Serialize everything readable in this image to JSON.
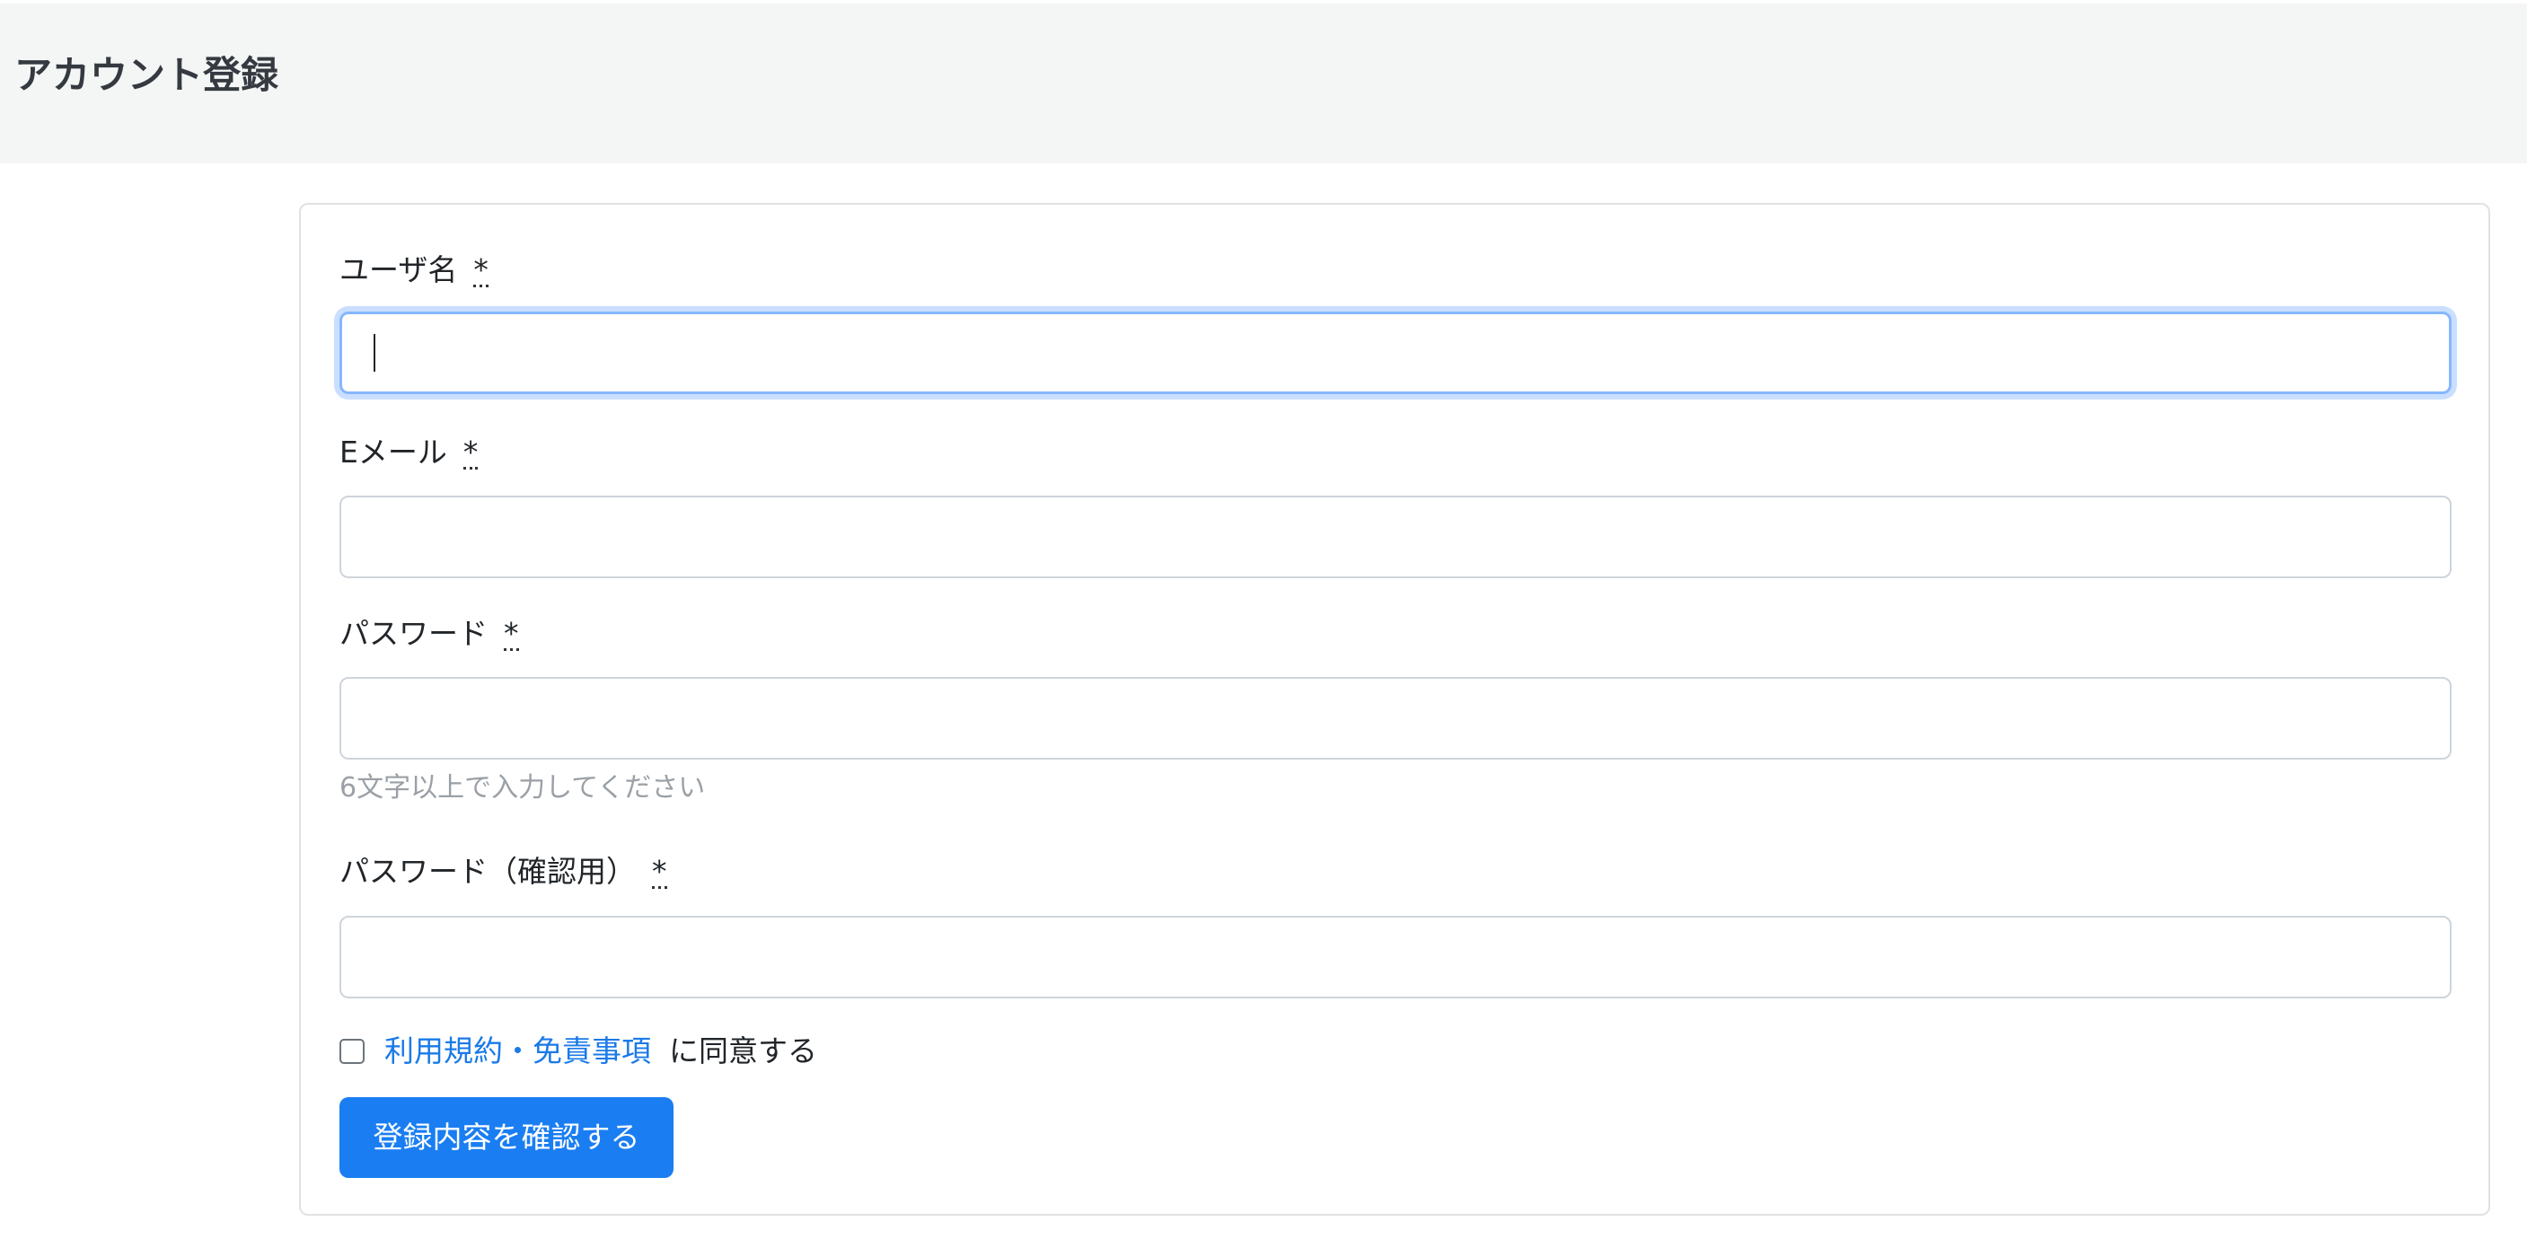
{
  "header": {
    "title": "アカウント登録"
  },
  "form": {
    "required_mark": "*",
    "username": {
      "label": "ユーザ名",
      "value": ""
    },
    "email": {
      "label": "Eメール",
      "value": ""
    },
    "password": {
      "label": "パスワード",
      "value": "",
      "help": "6文字以上で入力してください"
    },
    "password_confirm": {
      "label": "パスワード（確認用）",
      "value": ""
    },
    "terms": {
      "link_text": "利用規約・免責事項",
      "suffix": "に同意する",
      "checked": false
    },
    "submit_label": "登録内容を確認する"
  },
  "colors": {
    "header_bg": "#f4f5f5",
    "primary": "#1a7ef2",
    "link": "#1a7ae8",
    "focus_border": "#86b7fe"
  }
}
